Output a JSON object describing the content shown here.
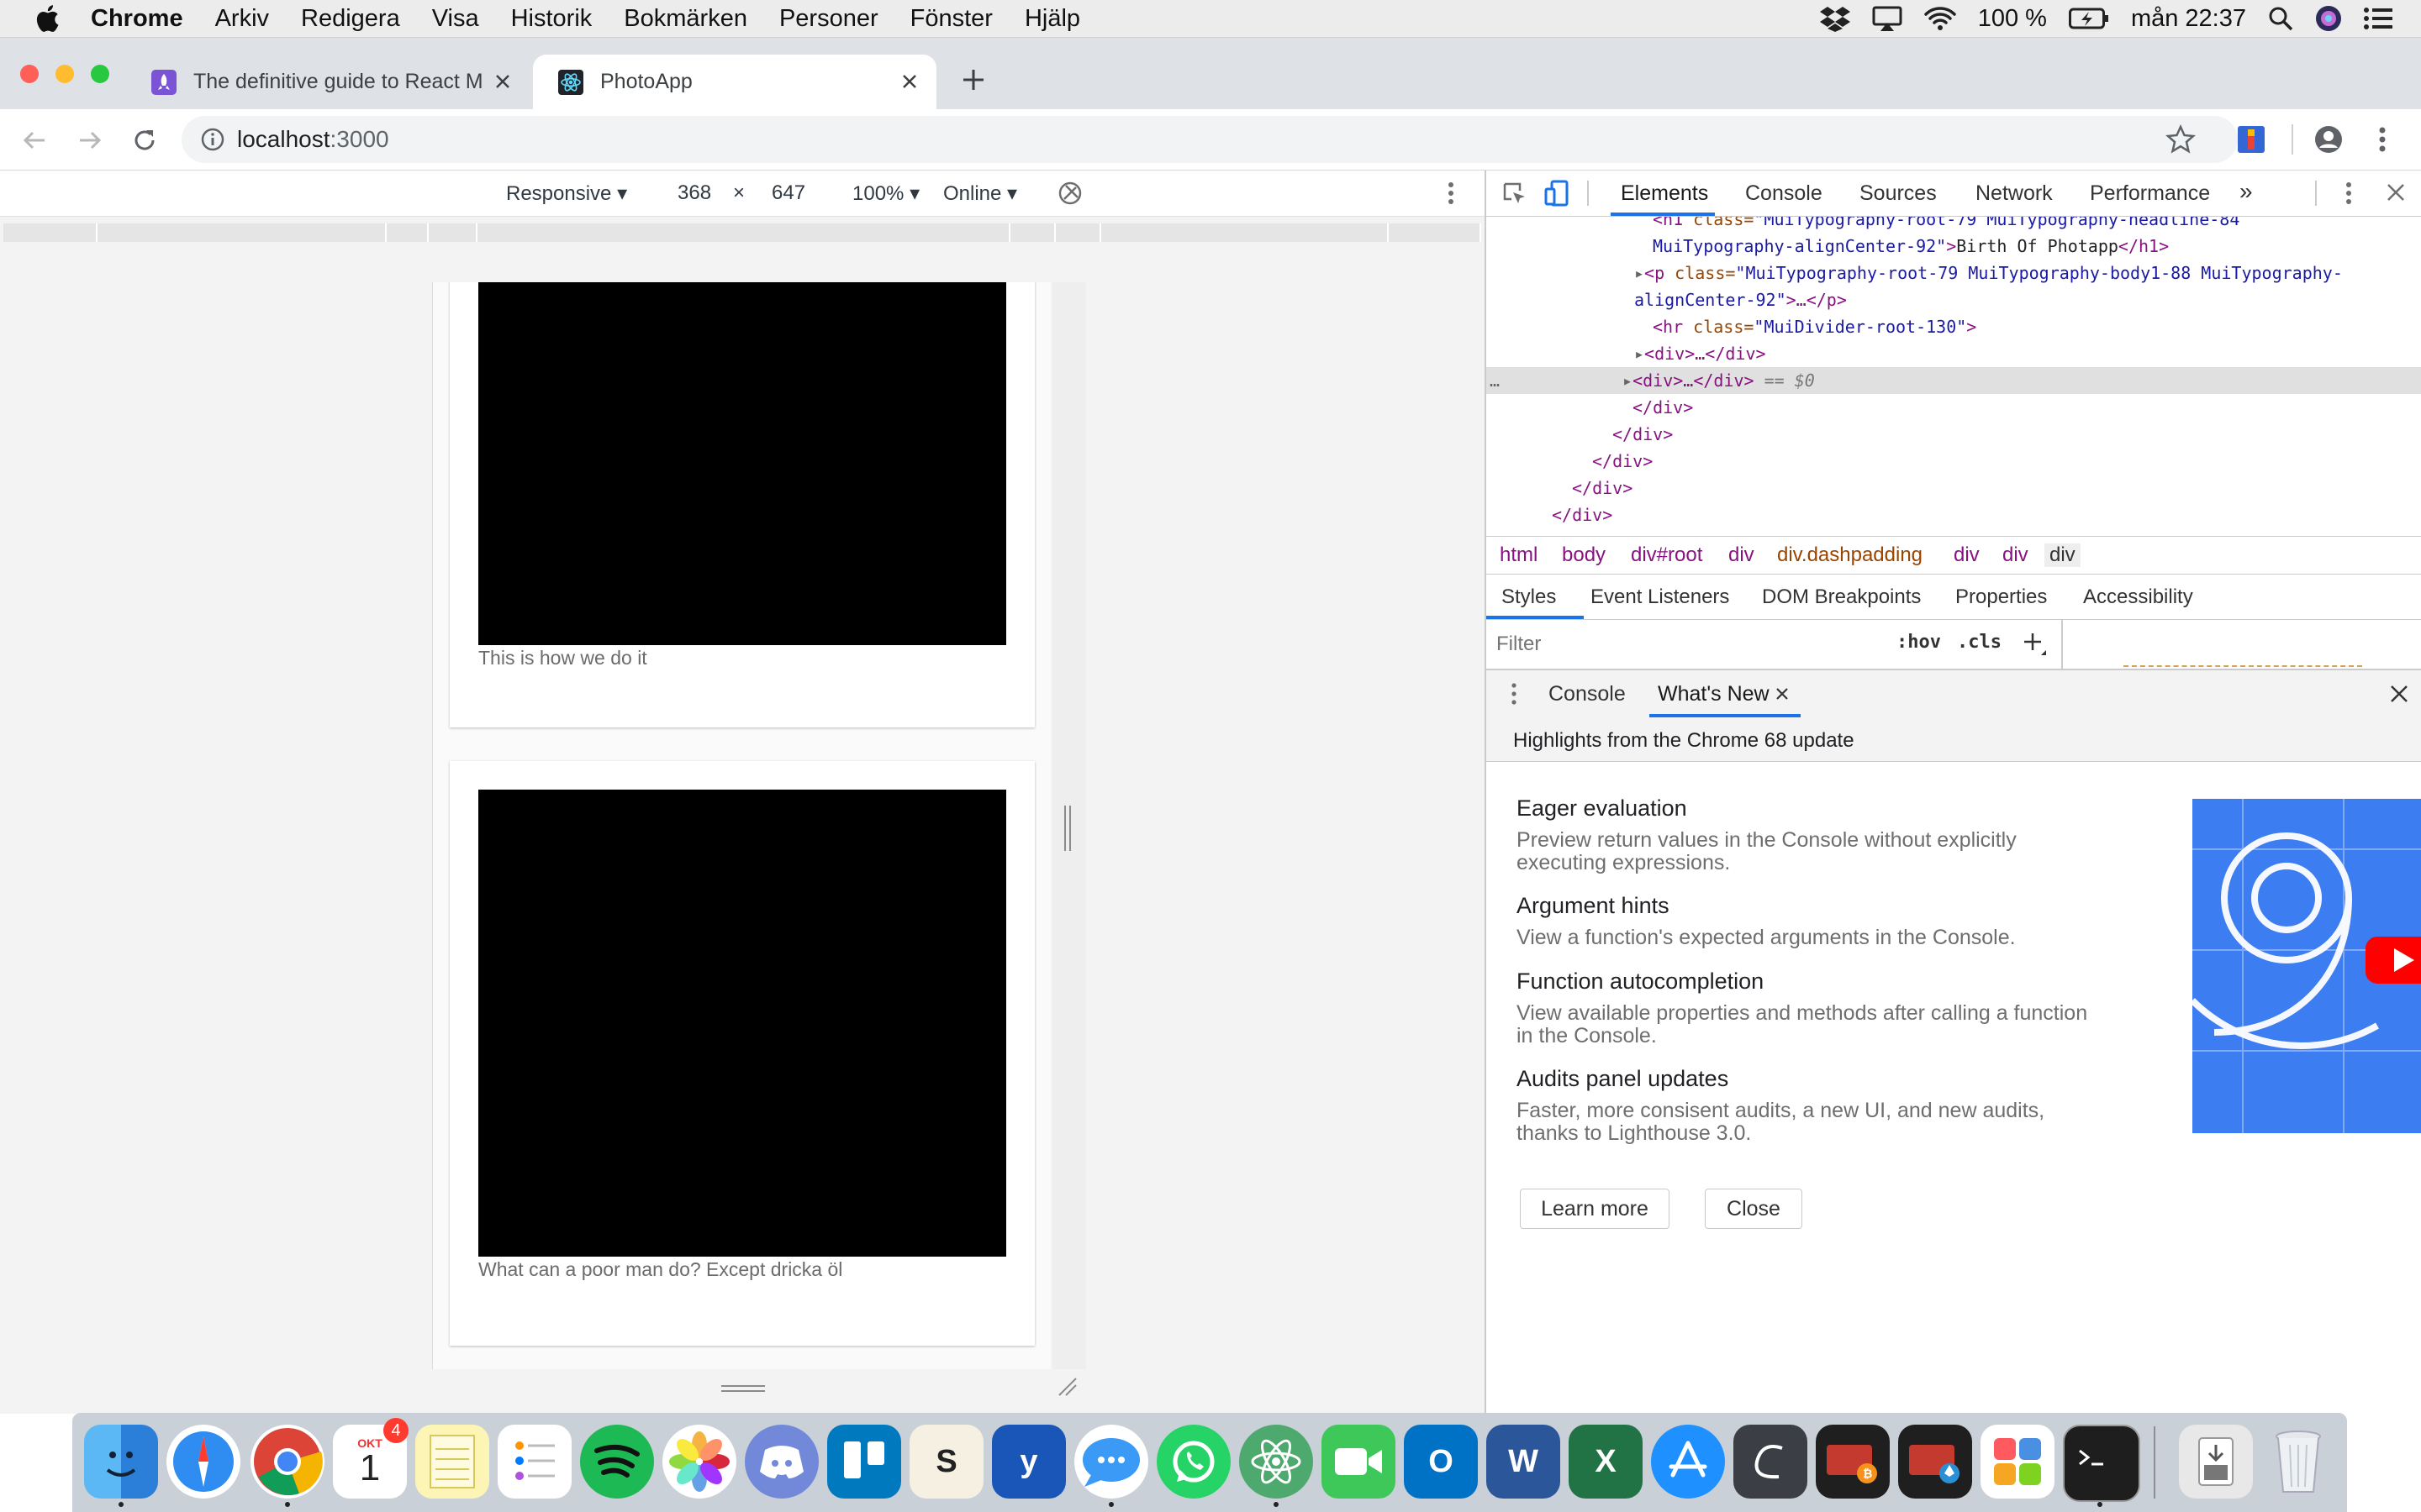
{
  "menubar": {
    "app": "Chrome",
    "items": [
      "Arkiv",
      "Redigera",
      "Visa",
      "Historik",
      "Bokmärken",
      "Personer",
      "Fönster",
      "Hjälp"
    ],
    "battery": "100 %",
    "clock": "mån 22:37"
  },
  "tabs": [
    {
      "title": "The definitive guide to React M",
      "active": false
    },
    {
      "title": "PhotoApp",
      "active": true
    }
  ],
  "address": {
    "host": "localhost",
    "port": ":3000"
  },
  "device_toolbar": {
    "preset": "Responsive",
    "width": "368",
    "times": "×",
    "height": "647",
    "zoom": "100%",
    "throttle": "Online"
  },
  "page": {
    "cards": [
      {
        "caption": "This is how we do it"
      },
      {
        "caption": "What can a poor man do? Except dricka öl"
      }
    ]
  },
  "devtools": {
    "tabs": [
      "Elements",
      "Console",
      "Sources",
      "Network",
      "Performance"
    ],
    "overflow": "»",
    "dom": {
      "l0_tag": "<h1 ",
      "l0_attr": "class=",
      "l0_val": "\"MuiTypography-root-79 MuiTypography-headline-84",
      "l1_val": "MuiTypography-alignCenter-92\"",
      "l1_text": "Birth Of Photapp",
      "l1_close": "</h1>",
      "l2_tag": "<p ",
      "l2_attr": "class=",
      "l2_val": "\"MuiTypography-root-79 MuiTypography-body1-88 MuiTypography-",
      "l3_val": "alignCenter-92\"",
      "l3_rest": ">…</p>",
      "l4_tag": "<hr ",
      "l4_attr": "class=",
      "l4_val": "\"MuiDivider-root-130\"",
      "l4_close": ">",
      "l5": "<div>…</div>",
      "l6": "<div>…</div>",
      "l6_eq": " == $0",
      "l7": "</div>",
      "l8": "</div>",
      "l9": "</div>",
      "l10": "</div>",
      "l11": "</div>"
    },
    "breadcrumbs": [
      "html",
      "body",
      "div#root",
      "div",
      "div.dashpadding",
      "div",
      "div",
      "div"
    ],
    "style_tabs": [
      "Styles",
      "Event Listeners",
      "DOM Breakpoints",
      "Properties",
      "Accessibility"
    ],
    "filter_placeholder": "Filter",
    "hov": ":hov",
    "cls": ".cls",
    "drawer_tabs": [
      "Console",
      "What's New"
    ],
    "whats_new": {
      "banner": "Highlights from the Chrome 68 update",
      "features": [
        {
          "title": "Eager evaluation",
          "desc": "Preview return values in the Console without explicitly executing expressions."
        },
        {
          "title": "Argument hints",
          "desc": "View a function's expected arguments in the Console."
        },
        {
          "title": "Function autocompletion",
          "desc": "View available properties and methods after calling a function in the Console."
        },
        {
          "title": "Audits panel updates",
          "desc": "Faster, more consisent audits, a new UI, and new audits, thanks to Lighthouse 3.0."
        }
      ],
      "learn_more": "Learn more",
      "close": "Close"
    }
  },
  "dock": {
    "calendar_month": "OKT",
    "calendar_day": "1",
    "calendar_badge": "4",
    "apps": [
      "finder-icon",
      "safari-icon",
      "chrome-icon",
      "calendar-icon",
      "notes-icon",
      "reminders-icon",
      "spotify-icon",
      "photos-icon",
      "discord-icon",
      "trello-icon",
      "slides-icon",
      "yammer-icon",
      "messages-icon",
      "whatsapp-icon",
      "atom-icon",
      "facetime-icon",
      "outlook-icon",
      "word-icon",
      "excel-icon",
      "appstore-icon",
      "scrivener-icon",
      "wallet-btc-icon",
      "wallet-eth-icon",
      "launchpad-icon",
      "terminal-icon",
      "downloads-icon",
      "trash-icon"
    ]
  },
  "colors": {
    "accent": "#1a73e8",
    "tabstrip": "#dee1e6",
    "photo": "#000000",
    "whatsnew_art": "#3d7df2"
  }
}
